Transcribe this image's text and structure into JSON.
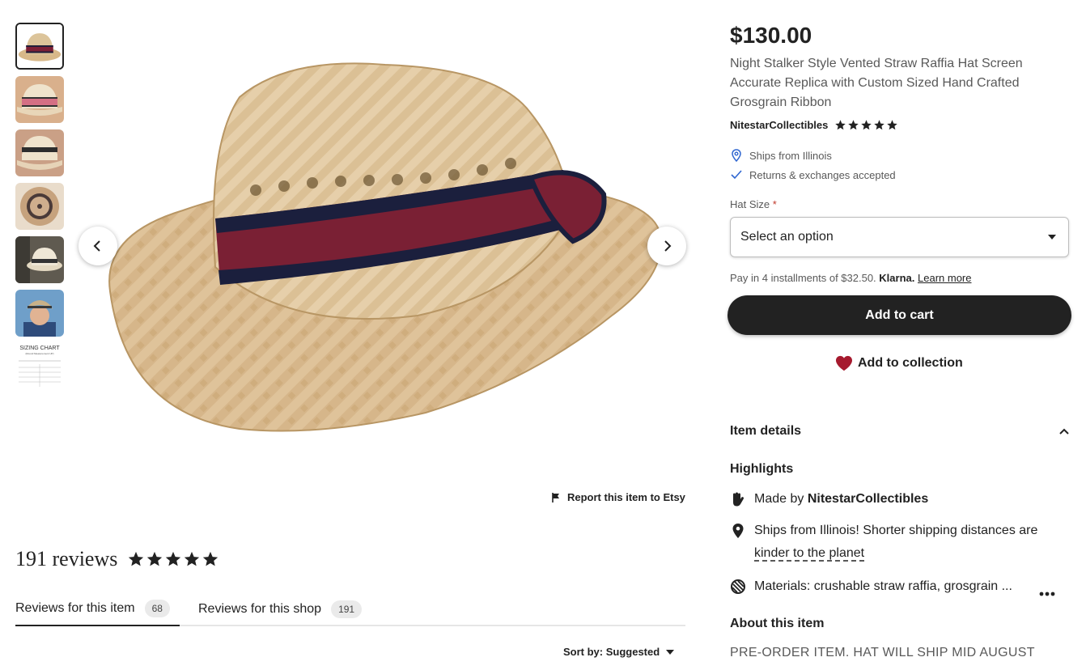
{
  "gallery": {
    "thumbnails": [
      "hat-side-view",
      "hat-front-view",
      "hat-angle-view",
      "hat-top-view",
      "hat-on-mannequin",
      "person-wearing-hat",
      "sizing-chart"
    ],
    "sizing_chart_text": "SIZING CHART",
    "sizing_chart_sub": "(Round Measurement UP)",
    "prev_icon": "chevron-left-icon",
    "next_icon": "chevron-right-icon"
  },
  "report": {
    "label": "Report this item to Etsy",
    "icon": "flag-icon"
  },
  "reviews": {
    "count_label": "191 reviews",
    "rating": 5,
    "tabs": [
      {
        "label": "Reviews for this item",
        "count": "68"
      },
      {
        "label": "Reviews for this shop",
        "count": "191"
      }
    ],
    "sort_label": "Sort by: Suggested"
  },
  "listing": {
    "price": "$130.00",
    "title": "Night Stalker Style Vented Straw Raffia Hat Screen Accurate Replica with Custom Sized Hand Crafted Grosgrain Ribbon",
    "shop_name": "NitestarCollectibles",
    "shop_rating": 5,
    "ships_from": "Ships from Illinois",
    "returns": "Returns & exchanges accepted",
    "hat_size_label": "Hat Size",
    "required_mark": "*",
    "select_value": "Select an option",
    "klarna_prefix": "Pay in 4 installments of $32.50.",
    "klarna_brand": "Klarna.",
    "klarna_link": "Learn more",
    "add_to_cart": "Add to cart",
    "add_to_collection": "Add to collection"
  },
  "details": {
    "section_title": "Item details",
    "highlights_title": "Highlights",
    "made_by_prefix": "Made by",
    "made_by_shop": "NitestarCollectibles",
    "ships_text": "Ships from Illinois! Shorter shipping distances are",
    "ships_link": "kinder to the planet",
    "materials": "Materials: crushable straw raffia, grosgrain ...",
    "about_title": "About this item",
    "description": "PRE-ORDER ITEM. HAT WILL SHIP MID AUGUST"
  },
  "colors": {
    "accent": "#222222",
    "heart": "#a61a2e",
    "pin": "#2f66d0",
    "text_muted": "#595959"
  }
}
